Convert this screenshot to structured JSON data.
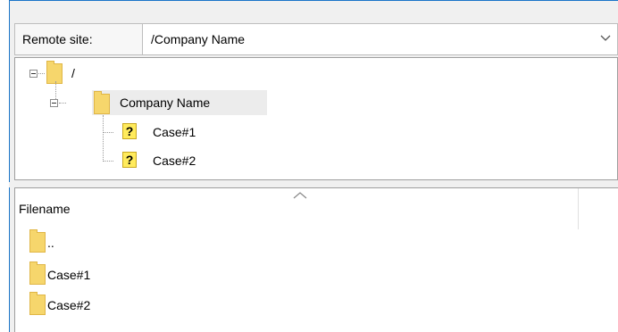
{
  "remote_site": {
    "label": "Remote site:",
    "path": "/Company Name",
    "dropdown_icon": "chevron-down-icon"
  },
  "tree": {
    "nodes": [
      {
        "label": "/",
        "icon": "folder-icon",
        "expanded": true
      },
      {
        "label": "Company Name",
        "icon": "folder-icon",
        "expanded": true,
        "selected": true
      },
      {
        "label": "Case#1",
        "icon": "unknown-folder-icon"
      },
      {
        "label": "Case#2",
        "icon": "unknown-folder-icon"
      }
    ]
  },
  "file_list": {
    "column_header": "Filename",
    "sort_icon": "sort-ascending-icon",
    "rows": [
      {
        "name": "..",
        "icon": "folder-icon"
      },
      {
        "name": "Case#1",
        "icon": "folder-icon"
      },
      {
        "name": "Case#2",
        "icon": "folder-icon"
      }
    ]
  },
  "colors": {
    "folder": "#f6d66c",
    "selection": "#ececec",
    "frame_accent": "#1a74c8"
  }
}
